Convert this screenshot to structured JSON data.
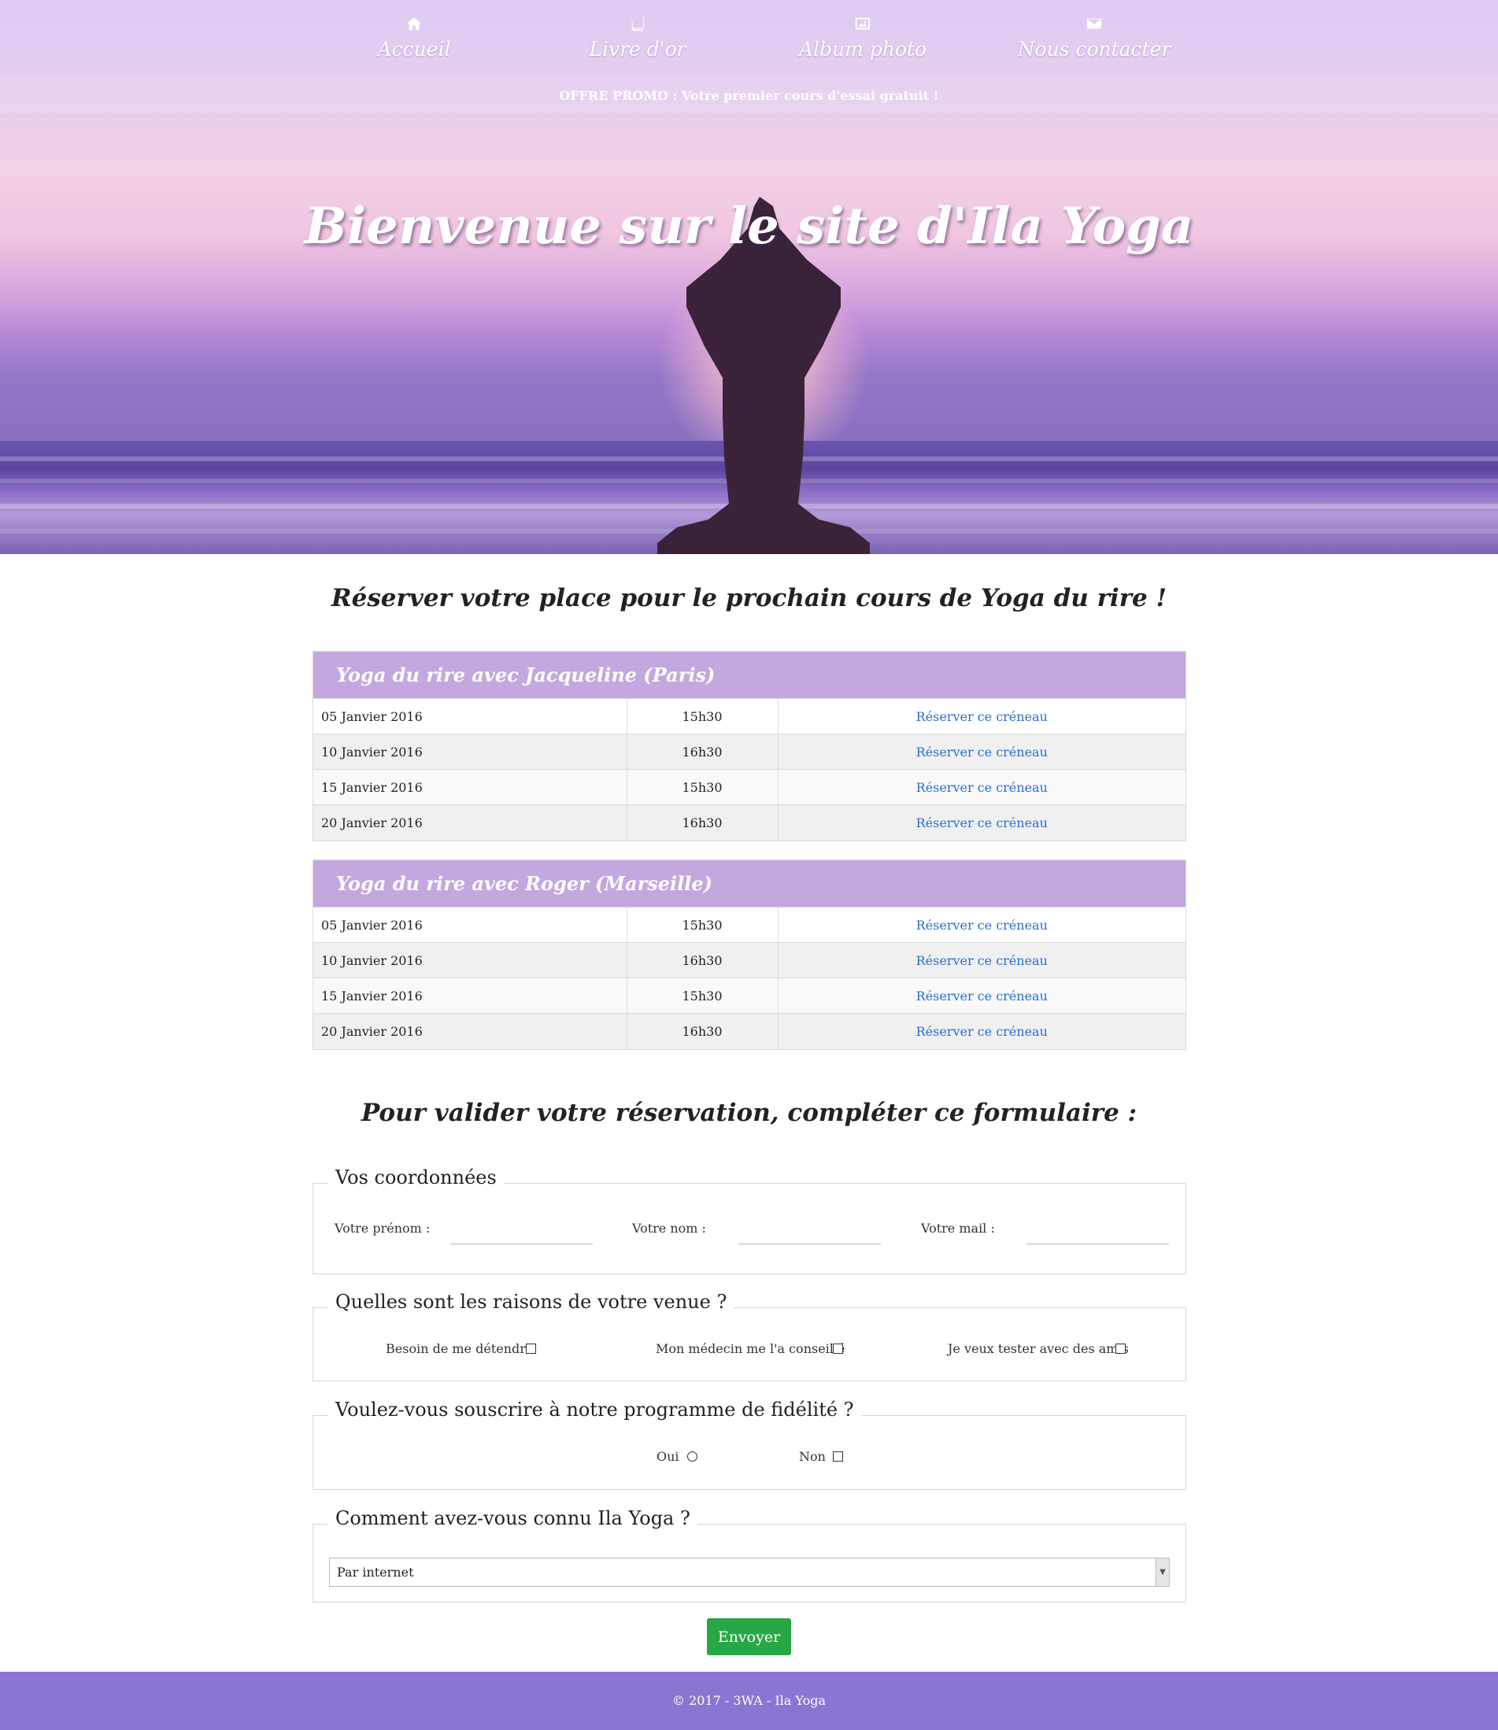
{
  "nav": {
    "items": [
      {
        "label": "Accueil",
        "icon": "home-icon"
      },
      {
        "label": "Livre d'or",
        "icon": "book-icon"
      },
      {
        "label": "Album photo",
        "icon": "image-icon"
      },
      {
        "label": "Nous contacter",
        "icon": "envelope-icon"
      }
    ]
  },
  "promo": "OFFRE PROMO : Votre premier cours d'essai gratuit !",
  "hero": {
    "title": "Bienvenue sur le site d'Ila Yoga"
  },
  "booking": {
    "title": "Réserver votre place pour le prochain cours de Yoga du rire !",
    "schedules": [
      {
        "heading": "Yoga du rire avec Jacqueline (Paris)",
        "rows": [
          {
            "date": "05 Janvier 2016",
            "time": "15h30",
            "link": "Réserver ce créneau"
          },
          {
            "date": "10 Janvier 2016",
            "time": "16h30",
            "link": "Réserver ce créneau"
          },
          {
            "date": "15 Janvier 2016",
            "time": "15h30",
            "link": "Réserver ce créneau"
          },
          {
            "date": "20 Janvier 2016",
            "time": "16h30",
            "link": "Réserver ce créneau"
          }
        ]
      },
      {
        "heading": "Yoga du rire avec Roger (Marseille)",
        "rows": [
          {
            "date": "05 Janvier 2016",
            "time": "15h30",
            "link": "Réserver ce créneau"
          },
          {
            "date": "10 Janvier 2016",
            "time": "16h30",
            "link": "Réserver ce créneau"
          },
          {
            "date": "15 Janvier 2016",
            "time": "15h30",
            "link": "Réserver ce créneau"
          },
          {
            "date": "20 Janvier 2016",
            "time": "16h30",
            "link": "Réserver ce créneau"
          }
        ]
      }
    ]
  },
  "form": {
    "title": "Pour valider votre réservation, compléter ce formulaire :",
    "coordinates": {
      "legend": "Vos coordonnées",
      "firstname_label": "Votre prénom :",
      "lastname_label": "Votre nom :",
      "email_label": "Votre mail :"
    },
    "reasons": {
      "legend": "Quelles sont les raisons de votre venue ?",
      "options": [
        "Besoin de me détendre",
        "Mon médecin me l'a conseillé",
        "Je veux tester avec des amis"
      ]
    },
    "loyalty": {
      "legend": "Voulez-vous souscrire à notre programme de fidélité ?",
      "yes": "Oui",
      "no": "Non"
    },
    "source": {
      "legend": "Comment avez-vous connu Ila Yoga ?",
      "selected": "Par internet"
    },
    "submit": "Envoyer"
  },
  "footer": "© 2017 - 3WA - Ila Yoga",
  "colors": {
    "schedule_header": "#c3a8e0",
    "link": "#2d6ed1",
    "submit": "#28a745",
    "footer": "#8a75d2"
  }
}
